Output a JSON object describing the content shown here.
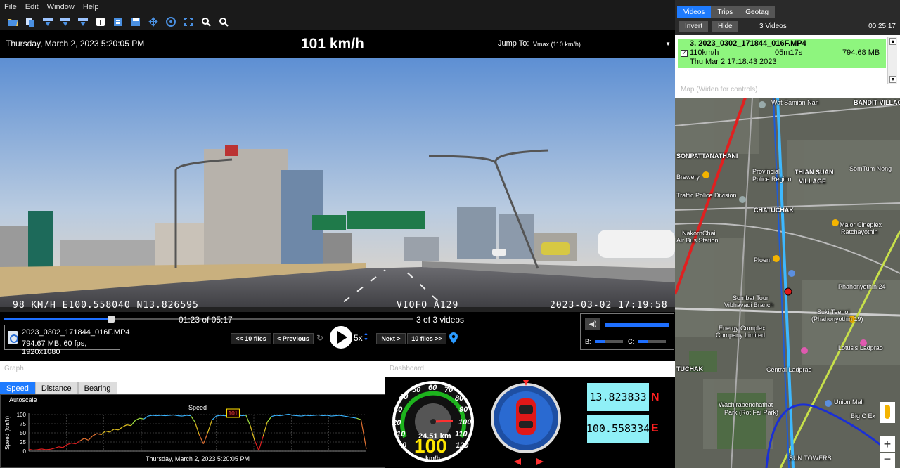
{
  "menu": {
    "items": [
      "File",
      "Edit",
      "Window",
      "Help"
    ]
  },
  "toolbar": {
    "icons": [
      "open-folder-icon",
      "copy-files-icon",
      "export-icon",
      "data-export-icon",
      "mov-export-icon",
      "info-icon",
      "video-edit-icon",
      "save-icon",
      "move-icon",
      "circle-target-icon",
      "fit-icon",
      "zoom-in-icon",
      "zoom-out-icon"
    ]
  },
  "infobar": {
    "datetime": "Thursday, March 2, 2023 5:20:05 PM",
    "speed": "101 km/h",
    "jump_label": "Jump To:",
    "jump_value": "Vmax (110 km/h)"
  },
  "video": {
    "overlay_left": "98 KM/H E100.558040 N13.826595",
    "overlay_mid": "VIOFO A129",
    "overlay_right": "2023-03-02 17:19:58"
  },
  "player": {
    "time": "01:23 of 05:17",
    "count": "3 of 3 videos",
    "progress": 0.262,
    "file_name": "2023_0302_171844_016F.MP4",
    "file_meta": "794.67 MB, 60 fps, 1920x1080",
    "prev10": "<< 10 files",
    "prev": "< Previous",
    "speed_mult": "5x",
    "next": "Next >",
    "next10": "10 files >>",
    "b_label": "B:",
    "c_label": "C:"
  },
  "graph": {
    "header": "Graph",
    "tabs": [
      "Speed",
      "Distance",
      "Bearing"
    ],
    "autoscale": "Autoscale"
  },
  "dashboard": {
    "header": "Dashboard",
    "coord_n": "13.823833",
    "coord_e": "100.558334",
    "n_label": "N",
    "e_label": "E",
    "speed_digital": "100",
    "speed_unit": "km/h",
    "odometer": "24.51 km"
  },
  "chart_data": {
    "type": "line",
    "title": "Speed",
    "xlabel": "Thursday, March 2, 2023 5:20:05 PM",
    "ylabel": "Speed (km/h)",
    "ylim": [
      0,
      100
    ],
    "yticks": [
      0,
      25,
      50,
      75,
      100
    ],
    "marker_label": "101",
    "grid": true,
    "x": [
      0,
      4,
      8,
      12,
      16,
      20,
      24,
      28,
      32,
      36,
      40,
      44,
      48,
      52,
      56,
      60,
      64,
      68,
      72,
      76,
      80,
      84,
      88,
      92,
      96,
      100,
      104,
      108,
      112,
      116,
      120,
      124,
      128,
      132,
      136,
      140,
      144,
      148,
      152,
      156,
      160,
      164,
      168,
      172,
      176,
      180,
      184,
      188,
      192,
      196,
      200,
      204,
      208,
      212,
      216,
      220,
      224,
      228,
      232,
      236,
      240,
      244,
      248,
      252,
      256,
      260,
      264,
      268,
      272,
      276,
      280,
      284,
      288,
      292,
      296,
      300,
      304,
      308,
      312,
      317
    ],
    "values": [
      5,
      3,
      4,
      6,
      4,
      5,
      8,
      12,
      10,
      18,
      22,
      20,
      28,
      35,
      30,
      42,
      48,
      45,
      55,
      52,
      60,
      58,
      66,
      72,
      70,
      84,
      90,
      88,
      96,
      98,
      97,
      98,
      97,
      98,
      99,
      97,
      96,
      98,
      97,
      80,
      45,
      20,
      50,
      85,
      96,
      98,
      97,
      96,
      98,
      99,
      97,
      98,
      70,
      30,
      2,
      40,
      80,
      95,
      98,
      97,
      99,
      101,
      98,
      97,
      96,
      98,
      97,
      98,
      99,
      97,
      98,
      96,
      97,
      98,
      96,
      94,
      92,
      90,
      86,
      6
    ]
  },
  "right_panel": {
    "tabs": [
      "Videos",
      "Trips",
      "Geotag"
    ],
    "invert": "Invert",
    "hide": "Hide",
    "count": "3 Videos",
    "duration": "00:25:17",
    "item_title": "3. 2023_0302_171844_016F.MP4",
    "item_speed": "110km/h",
    "item_length": "05m17s",
    "item_size": "794.68 MB",
    "item_date": "Thu Mar 2 17:18:43 2023",
    "map_header": "Map (Widen for controls)"
  },
  "map": {
    "labels": [
      {
        "text": "Wat Samian Nari",
        "cls": ""
      },
      {
        "text": "BANDIT VILLAGE",
        "cls": ""
      },
      {
        "text": "SONPATTANATHANI",
        "cls": ""
      },
      {
        "text": "THIAN SUAN",
        "cls": ""
      },
      {
        "text": "VILLAGE",
        "cls": ""
      },
      {
        "text": "Provincial",
        "cls": "small"
      },
      {
        "text": "Police Region",
        "cls": "small"
      },
      {
        "text": "SomTum Nong",
        "cls": "small"
      },
      {
        "text": "Brewery",
        "cls": "small"
      },
      {
        "text": "Traffic Police Division",
        "cls": "small"
      },
      {
        "text": "CHATUCHAK",
        "cls": ""
      },
      {
        "text": "NakornChai",
        "cls": "small"
      },
      {
        "text": "Air Bus Station",
        "cls": "small"
      },
      {
        "text": "Major Cineplex",
        "cls": "small"
      },
      {
        "text": "Ratchayothin",
        "cls": "small"
      },
      {
        "text": "Ploen",
        "cls": "small"
      },
      {
        "text": "Phahonyothin 24",
        "cls": "small"
      },
      {
        "text": "Sombat Tour",
        "cls": "small"
      },
      {
        "text": "Vibhavadi Branch",
        "cls": "small"
      },
      {
        "text": "Suki Teenoi",
        "cls": "small"
      },
      {
        "text": "(Phahonyothin 19)",
        "cls": "small"
      },
      {
        "text": "Energy Complex",
        "cls": "small"
      },
      {
        "text": "Company Limited",
        "cls": "small"
      },
      {
        "text": "Lotus's Ladprao",
        "cls": "small"
      },
      {
        "text": "TUCHAK",
        "cls": ""
      },
      {
        "text": "Central Ladprao",
        "cls": "small"
      },
      {
        "text": "Wachirabenchathat",
        "cls": "small"
      },
      {
        "text": "Park (Rot Fai Park)",
        "cls": "small"
      },
      {
        "text": "Union Mall",
        "cls": "small"
      },
      {
        "text": "Big C Ex",
        "cls": "small"
      },
      {
        "text": "SUN TOWERS",
        "cls": "small"
      }
    ]
  }
}
